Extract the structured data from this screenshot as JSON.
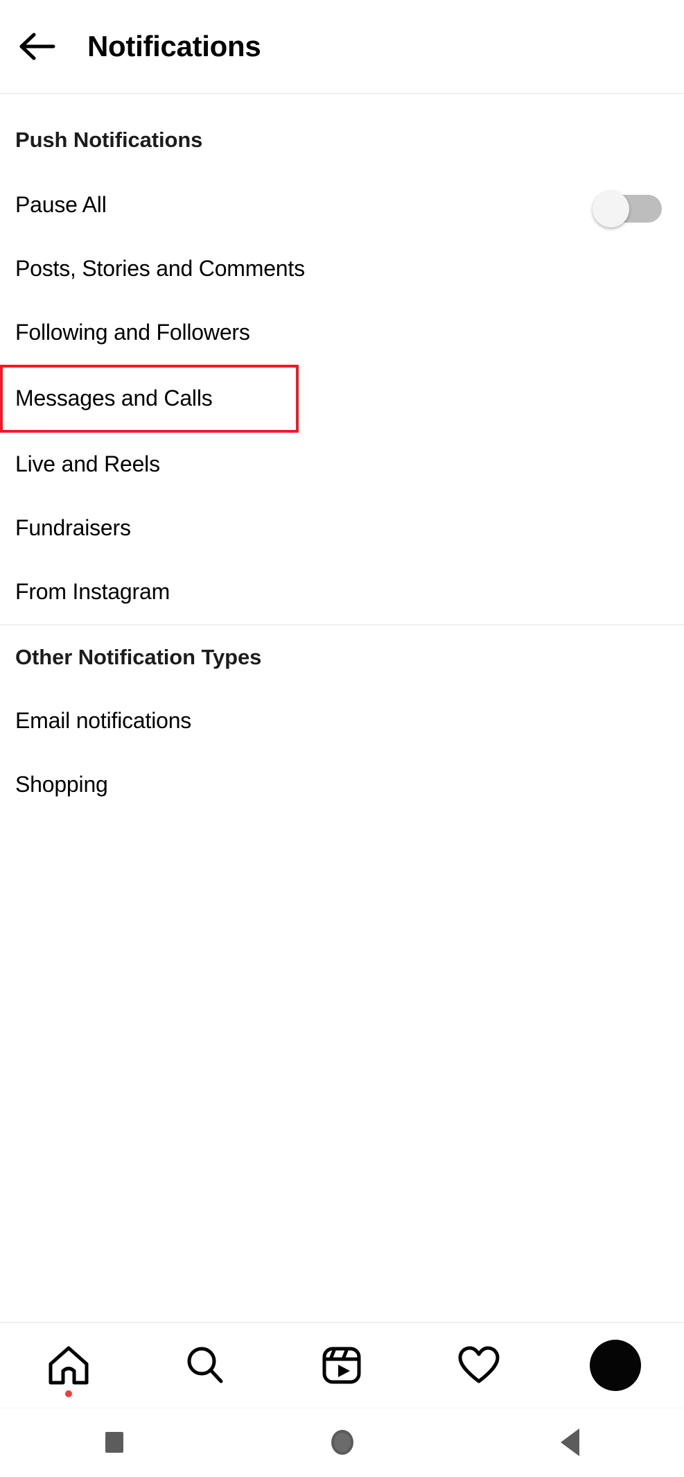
{
  "header": {
    "back_icon": "back-arrow-icon",
    "title": "Notifications"
  },
  "sections": [
    {
      "title": "Push Notifications",
      "rows": [
        {
          "label": "Pause All",
          "control": "toggle",
          "toggle_on": false
        },
        {
          "label": "Posts, Stories and Comments"
        },
        {
          "label": "Following and Followers"
        },
        {
          "label": "Messages and Calls",
          "highlighted": true
        },
        {
          "label": "Live and Reels"
        },
        {
          "label": "Fundraisers"
        },
        {
          "label": "From Instagram"
        }
      ]
    },
    {
      "title": "Other Notification Types",
      "rows": [
        {
          "label": "Email notifications"
        },
        {
          "label": "Shopping"
        }
      ]
    }
  ],
  "tabbar": {
    "items": [
      {
        "icon": "home-icon",
        "badge": true
      },
      {
        "icon": "search-icon"
      },
      {
        "icon": "reels-icon"
      },
      {
        "icon": "heart-icon"
      },
      {
        "icon": "profile-avatar"
      }
    ]
  },
  "system_nav": {
    "items": [
      {
        "icon": "recents-square-icon"
      },
      {
        "icon": "home-circle-icon"
      },
      {
        "icon": "back-triangle-icon"
      }
    ]
  },
  "colors": {
    "highlight": "#ef1b26",
    "toggle_track": "#bdbdbd",
    "toggle_knob": "#f4f4f4",
    "divider": "#efefef",
    "badge": "#ed3e3e",
    "sysnav_icon": "#5c5c5c"
  }
}
